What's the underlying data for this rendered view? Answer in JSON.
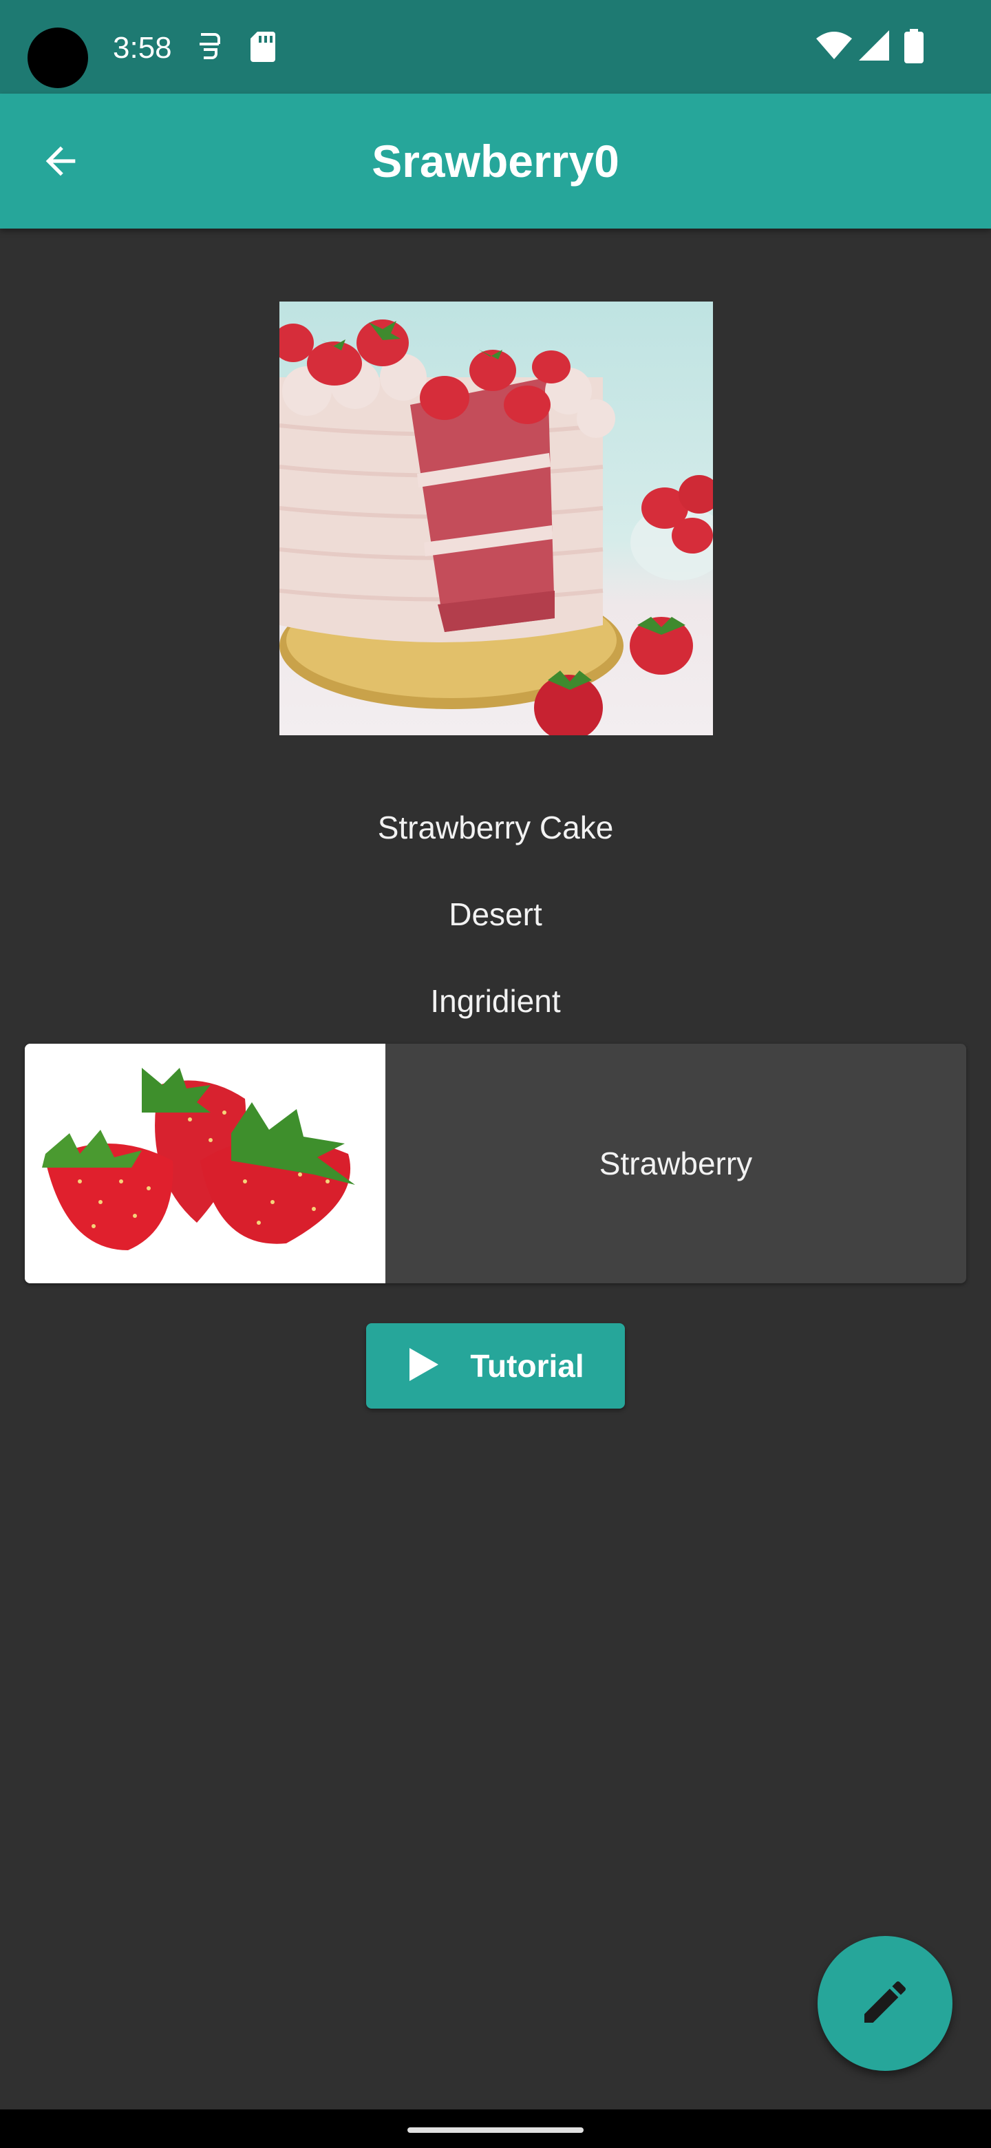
{
  "status_bar": {
    "time": "3:58"
  },
  "app_bar": {
    "title": "Srawberry0"
  },
  "recipe": {
    "name": "Strawberry Cake",
    "category": "Desert",
    "ingredients_heading": "Ingridient",
    "ingredients": [
      {
        "name": "Strawberry"
      }
    ]
  },
  "actions": {
    "tutorial_label": "Tutorial"
  },
  "colors": {
    "accent": "#26a69a",
    "status_bar": "#1e7a72",
    "background": "#303030",
    "card": "#424242"
  },
  "icons": {
    "back": "arrow-back-icon",
    "play": "play-icon",
    "edit": "pencil-icon"
  }
}
